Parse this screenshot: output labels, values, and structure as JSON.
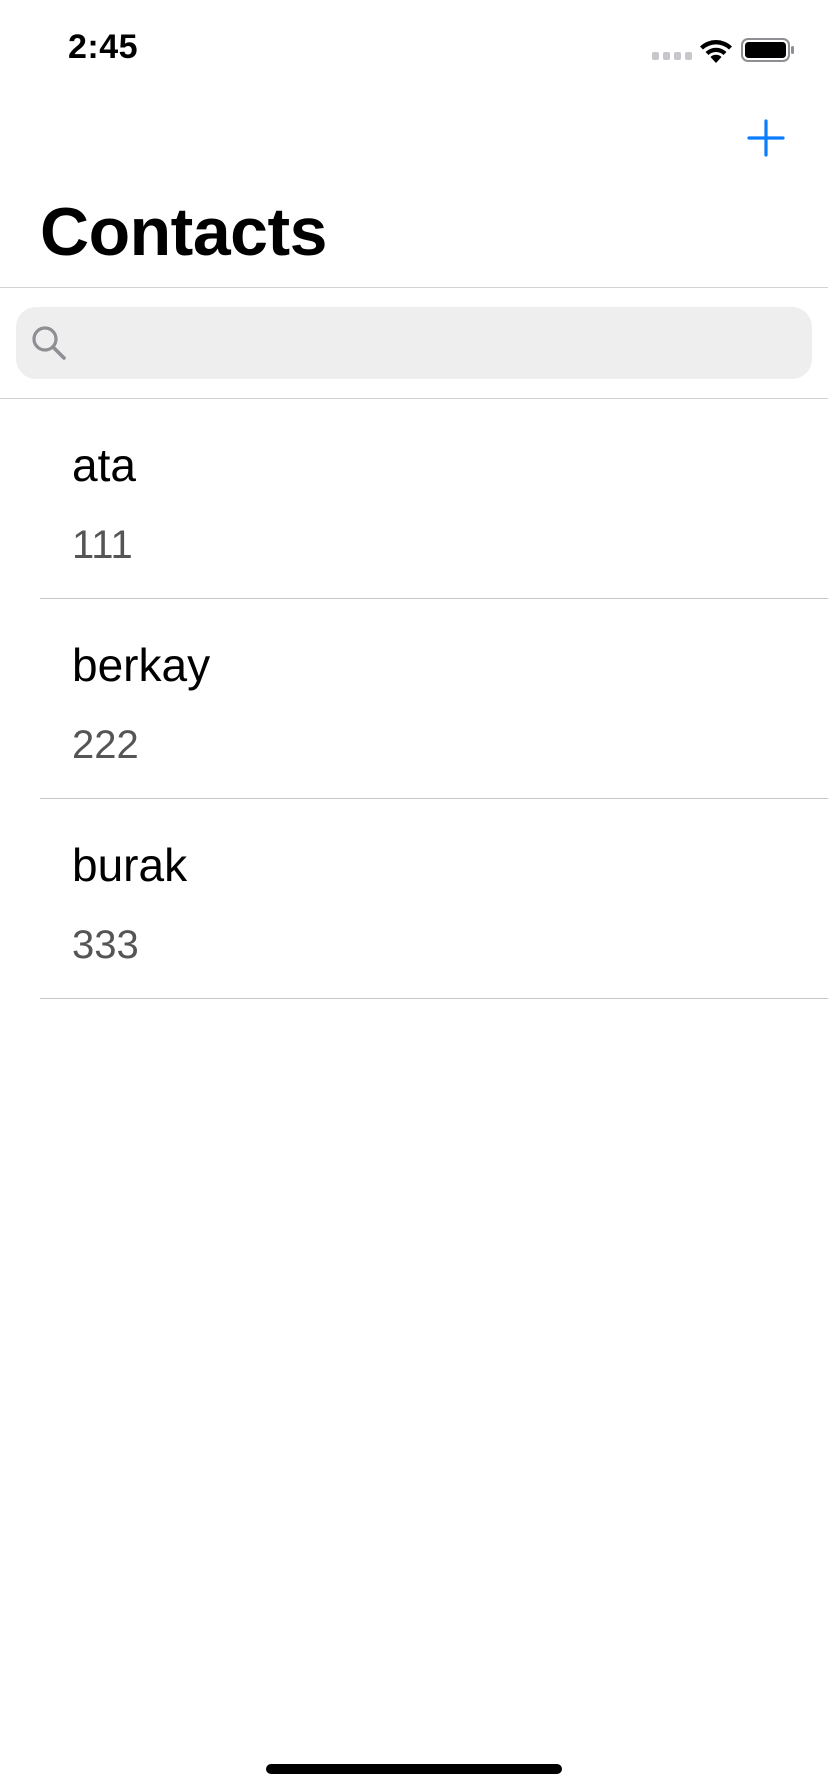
{
  "status_bar": {
    "time": "2:45",
    "signal_icon": "cellular-signal-icon",
    "wifi_icon": "wifi-icon",
    "battery_icon": "battery-icon"
  },
  "nav": {
    "title": "Contacts",
    "add_icon": "plus-icon",
    "accent_color": "#0a7cff"
  },
  "search": {
    "icon": "magnifying-glass-icon",
    "value": "",
    "placeholder": ""
  },
  "contacts": [
    {
      "name": "ata",
      "phone": "111"
    },
    {
      "name": "berkay",
      "phone": "222"
    },
    {
      "name": "burak",
      "phone": "333"
    }
  ]
}
